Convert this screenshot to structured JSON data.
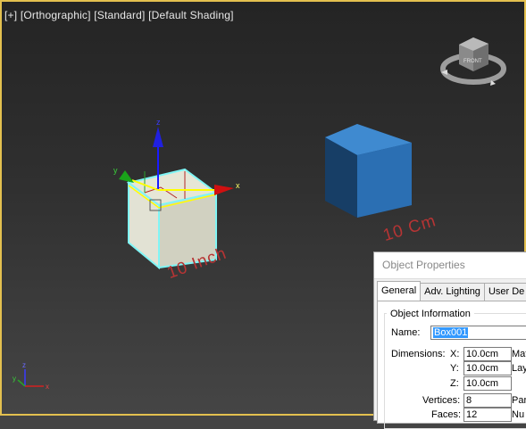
{
  "viewport": {
    "label_parts": [
      "[+]",
      "[Orthographic]",
      "[Standard]",
      "[Default Shading]"
    ],
    "cube_face_label": "FRONT",
    "dimension_labels": {
      "left_box": "10 Inch",
      "right_box": "10 Cm"
    },
    "gizmo_axes": {
      "x": "x",
      "y": "y",
      "z": "z"
    },
    "colors": {
      "border_active": "#e3c04f",
      "dimension_text": "#b63434",
      "selected_outline": "#7ff5f5",
      "right_box": "#2b6fb3"
    }
  },
  "dialog": {
    "title": "Object Properties",
    "tabs": [
      "General",
      "Adv. Lighting",
      "User De"
    ],
    "active_tab": "General",
    "group_title": "Object Information",
    "name_label": "Name:",
    "name_value": "Box001",
    "dimensions_label": "Dimensions:",
    "dims": [
      {
        "axis": "X:",
        "value": "10.0cm",
        "side": "Mat"
      },
      {
        "axis": "Y:",
        "value": "10.0cm",
        "side": "Lay"
      },
      {
        "axis": "Z:",
        "value": "10.0cm",
        "side": ""
      }
    ],
    "vertices_label": "Vertices:",
    "vertices_value": "8",
    "vertices_side": "Par",
    "faces_label": "Faces:",
    "faces_value": "12",
    "faces_side": "Nu"
  }
}
